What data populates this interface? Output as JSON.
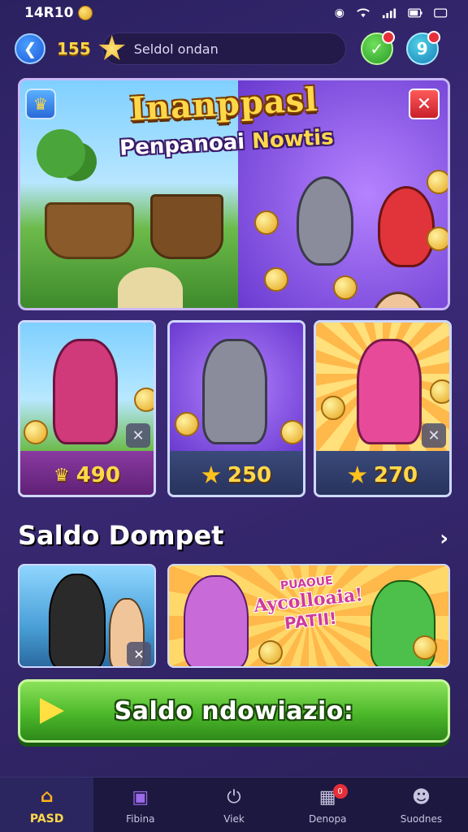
{
  "status_bar": {
    "time": "14R10",
    "battery_icon": "battery-icon",
    "wifi_icon": "wifi-icon"
  },
  "top_bar": {
    "coins": "155",
    "search_placeholder": "Seldol ondan",
    "green_btn_icon": "check-icon",
    "teal_btn_icon": "nine-icon",
    "teal_btn_glyph": "9"
  },
  "hero": {
    "title": "Inanppasl",
    "subtitle_a": "Penpanoai",
    "subtitle_b": "Nowtis"
  },
  "cards": [
    {
      "price": "490",
      "icon": "crown-icon"
    },
    {
      "price": "250",
      "icon": "star-icon"
    },
    {
      "price": "270",
      "icon": "star-icon"
    }
  ],
  "section": {
    "title": "Saldo Dompet"
  },
  "promo_tile": {
    "line1": "PUAOUE",
    "line2": "Aycolloaia!",
    "line3": "PATII!"
  },
  "cta": {
    "label": "Saldo ndowiazio:"
  },
  "bottom_nav": [
    {
      "label": "PASD",
      "icon": "home-icon",
      "active": true
    },
    {
      "label": "Fibina",
      "icon": "box-icon",
      "active": false
    },
    {
      "label": "Viek",
      "icon": "power-icon",
      "active": false
    },
    {
      "label": "Denopa",
      "icon": "calendar-icon",
      "active": false,
      "badge": "0"
    },
    {
      "label": "Suodnes",
      "icon": "people-icon",
      "active": false
    }
  ],
  "colors": {
    "accent": "#ffd84a",
    "cta": "#4cb82a",
    "bg": "#2b2160"
  }
}
